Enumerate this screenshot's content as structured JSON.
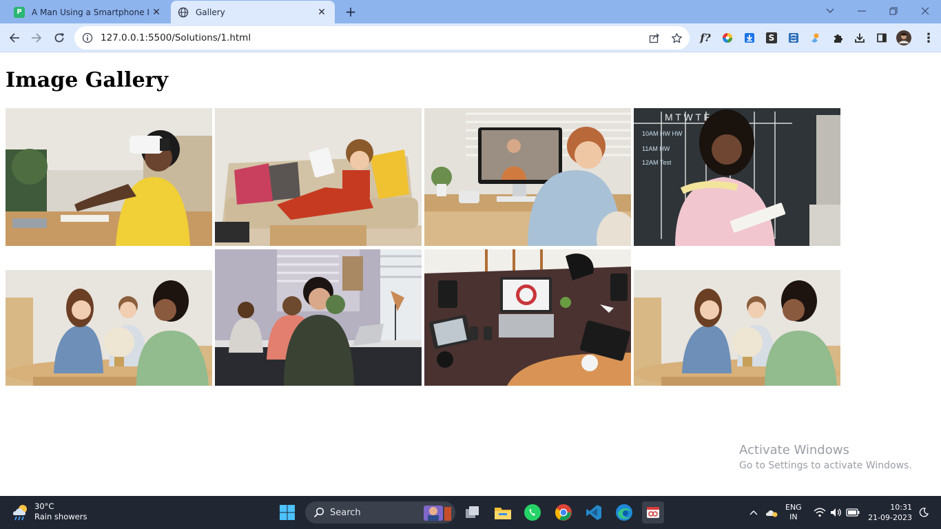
{
  "browser": {
    "tabs": [
      {
        "title": "A Man Using a Smartphone Inside",
        "active": false
      },
      {
        "title": "Gallery",
        "active": true
      }
    ],
    "url": "127.0.0.1:5500/Solutions/1.html"
  },
  "page": {
    "heading": "Image Gallery",
    "photos": [
      {
        "subject": "person wearing VR headset at desk"
      },
      {
        "subject": "child on sofa with tablet"
      },
      {
        "subject": "child in video call on computer"
      },
      {
        "subject": "girl with notebook by chalkboard"
      },
      {
        "subject": "woman and two children with globe"
      },
      {
        "subject": "students working at laptops"
      },
      {
        "subject": "desk with laptop and gadgets top view"
      },
      {
        "subject": "woman and two children with globe"
      }
    ]
  },
  "watermark": {
    "line1": "Activate Windows",
    "line2": "Go to Settings to activate Windows."
  },
  "taskbar": {
    "weather_temp": "30°C",
    "weather_desc": "Rain showers",
    "search_label": "Search",
    "lang_line1": "ENG",
    "lang_line2": "IN",
    "time": "10:31",
    "date": "21-09-2023"
  },
  "colors": {
    "tabstrip": "#8eb4ee",
    "toolbar": "#dde9fc",
    "taskbar": "#202632"
  }
}
